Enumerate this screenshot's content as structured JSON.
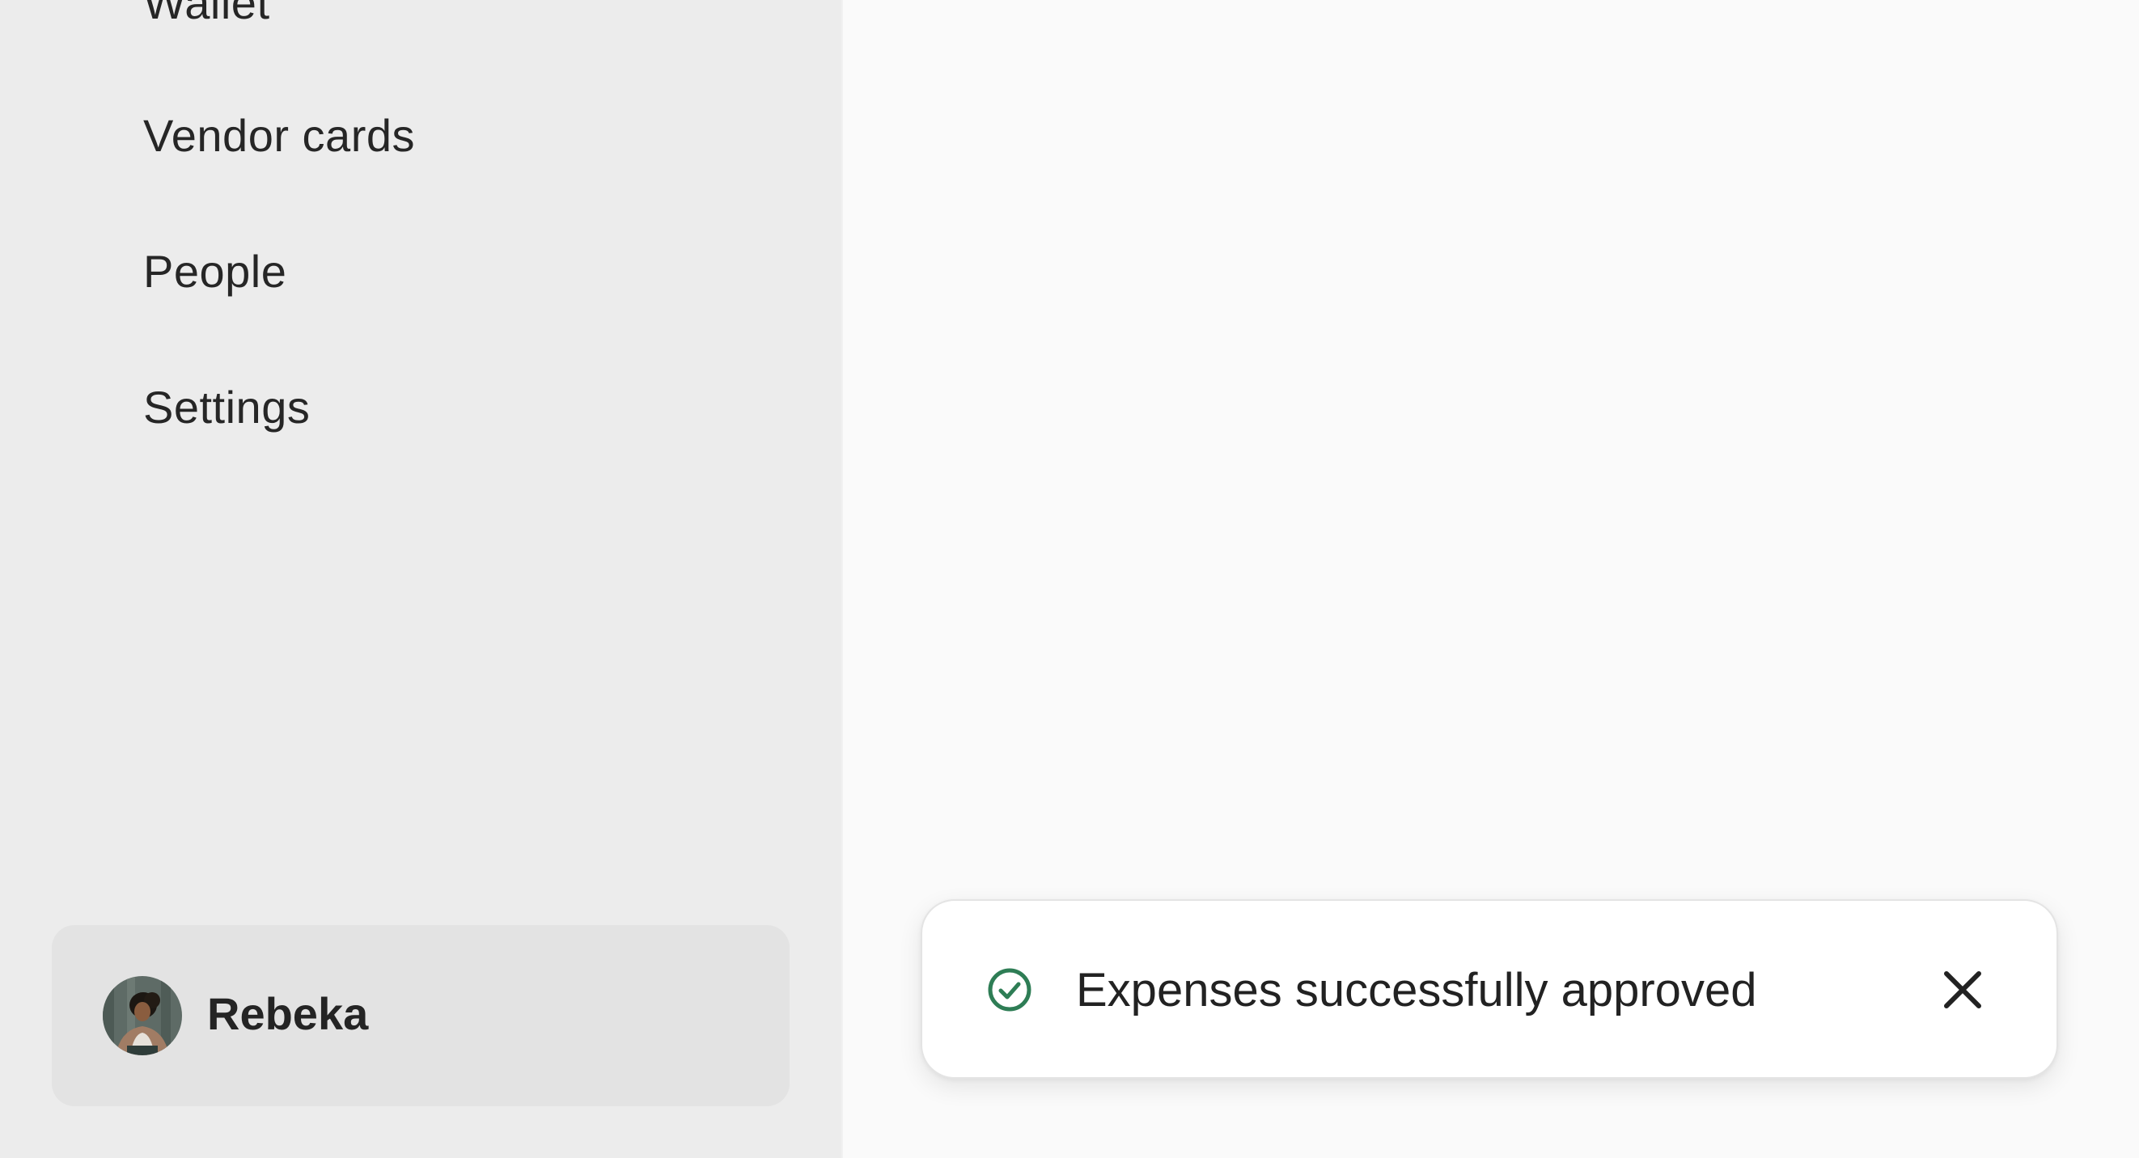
{
  "sidebar": {
    "items": [
      {
        "label": "Wallet"
      },
      {
        "label": "Vendor cards"
      },
      {
        "label": "People"
      },
      {
        "label": "Settings"
      }
    ],
    "user": {
      "name": "Rebeka",
      "avatar_icon": "user-avatar-photo"
    }
  },
  "toast": {
    "icon": "check-circle-icon",
    "message": "Expenses successfully approved",
    "close_icon": "close-icon"
  },
  "colors": {
    "sidebar_bg": "#ececec",
    "main_bg": "#fafafa",
    "user_card_bg": "#e3e3e3",
    "success": "#2e7d55",
    "text": "#262626"
  }
}
